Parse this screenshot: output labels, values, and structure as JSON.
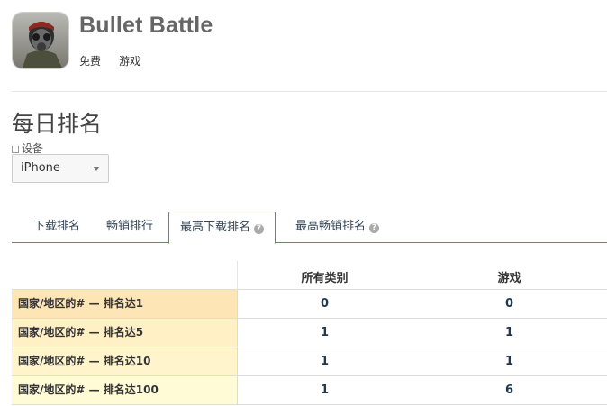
{
  "app": {
    "name": "Bullet Battle",
    "price": "免费",
    "category": "游戏"
  },
  "ranking": {
    "title": "每日排名",
    "device_label": "设备",
    "device_value": "iPhone"
  },
  "tabs": [
    {
      "label": "下载排名",
      "active": false,
      "help": false
    },
    {
      "label": "畅销排行",
      "active": false,
      "help": false
    },
    {
      "label": "最高下载排名",
      "active": true,
      "help": true
    },
    {
      "label": "最高畅销排名",
      "active": false,
      "help": true
    }
  ],
  "table": {
    "headers": [
      "所有类别",
      "游戏"
    ],
    "rows": [
      {
        "label": "国家/地区的# — 排名达1",
        "values": [
          "0",
          "0"
        ],
        "color": "#fde5b5"
      },
      {
        "label": "国家/地区的# — 排名达5",
        "values": [
          "1",
          "1"
        ],
        "color": "#fff0c6"
      },
      {
        "label": "国家/地区的# — 排名达10",
        "values": [
          "1",
          "1"
        ],
        "color": "#fff4cc"
      },
      {
        "label": "国家/地区的# — 排名达100",
        "values": [
          "1",
          "6"
        ],
        "color": "#fffbd6"
      }
    ]
  },
  "icons": {
    "app_icon": "soldier-gas-mask-icon",
    "help_icon": "question-circle-icon",
    "caret_icon": "caret-down-icon"
  }
}
